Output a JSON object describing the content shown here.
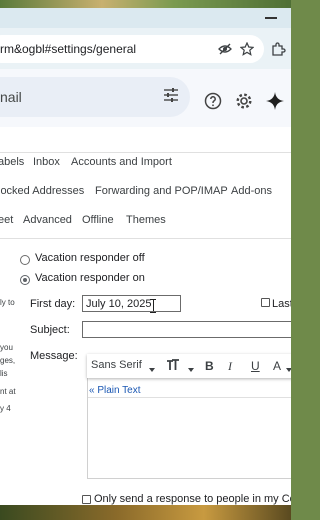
{
  "browser": {
    "url": "rm&ogbl#settings/general"
  },
  "gmail": {
    "search_text": "nail"
  },
  "settings": {
    "tab_row1": [
      "abels",
      "Inbox",
      "Accounts and Import"
    ],
    "tab_row2": [
      "locked Addresses",
      "Forwarding and POP/IMAP",
      "Add-ons"
    ],
    "tab_row3": [
      "eet",
      "Advanced",
      "Offline",
      "Themes"
    ],
    "vacation": {
      "off_label": "Vacation responder off",
      "on_label": "Vacation responder on",
      "selected": "on"
    },
    "side_notes": [
      "ly to",
      "you",
      "ges,",
      "lis",
      "nt at",
      "y 4"
    ],
    "first_day_label": "First day:",
    "first_day_value": "July 10, 2025",
    "last_day_label": "Last",
    "subject_label": "Subject:",
    "subject_value": "",
    "message_label": "Message:",
    "toolbar": {
      "font": "Sans Serif",
      "bold": "B",
      "italic": "I",
      "underline": "U",
      "text_color": "A"
    },
    "plain_text_link": "« Plain Text",
    "only_send_label": "Only send a response to people in my Co"
  }
}
